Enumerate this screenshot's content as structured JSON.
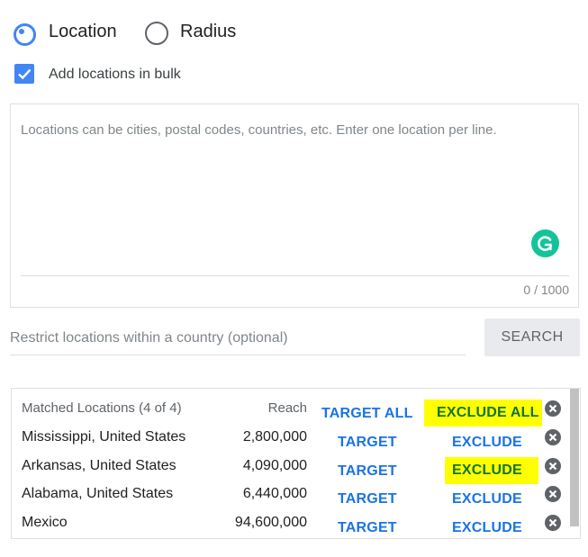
{
  "mode": {
    "options": [
      {
        "label": "Location",
        "selected": true
      },
      {
        "label": "Radius",
        "selected": false
      }
    ]
  },
  "bulk": {
    "checkbox_label": "Add locations in bulk",
    "checked": true,
    "textarea_value": "",
    "textarea_placeholder": "Locations can be cities, postal codes, countries, etc. Enter one location per line.",
    "char_count": "0 / 1000",
    "grammarly_icon": "grammarly-icon"
  },
  "restrict": {
    "placeholder": "Restrict locations within a country (optional)",
    "value": "",
    "search_label": "SEARCH"
  },
  "results": {
    "header": {
      "title": "Matched Locations (4 of 4)",
      "reach_label": "Reach",
      "target_all_label": "TARGET ALL",
      "exclude_all_label": "EXCLUDE ALL",
      "exclude_all_highlighted": true
    },
    "rows": [
      {
        "name": "Mississippi, United States",
        "reach": "2,800,000",
        "target_label": "TARGET",
        "exclude_label": "EXCLUDE",
        "exclude_highlighted": false
      },
      {
        "name": "Arkansas, United States",
        "reach": "4,090,000",
        "target_label": "TARGET",
        "exclude_label": "EXCLUDE",
        "exclude_highlighted": true
      },
      {
        "name": "Alabama, United States",
        "reach": "6,440,000",
        "target_label": "TARGET",
        "exclude_label": "EXCLUDE",
        "exclude_highlighted": false
      },
      {
        "name": "Mexico",
        "reach": "94,600,000",
        "target_label": "TARGET",
        "exclude_label": "EXCLUDE",
        "exclude_highlighted": false
      }
    ]
  },
  "colors": {
    "accent": "#4285f4",
    "link": "#1a73e8",
    "highlight": "#ffff00",
    "highlight_text": "#137333",
    "grammarly": "#15c39a"
  }
}
